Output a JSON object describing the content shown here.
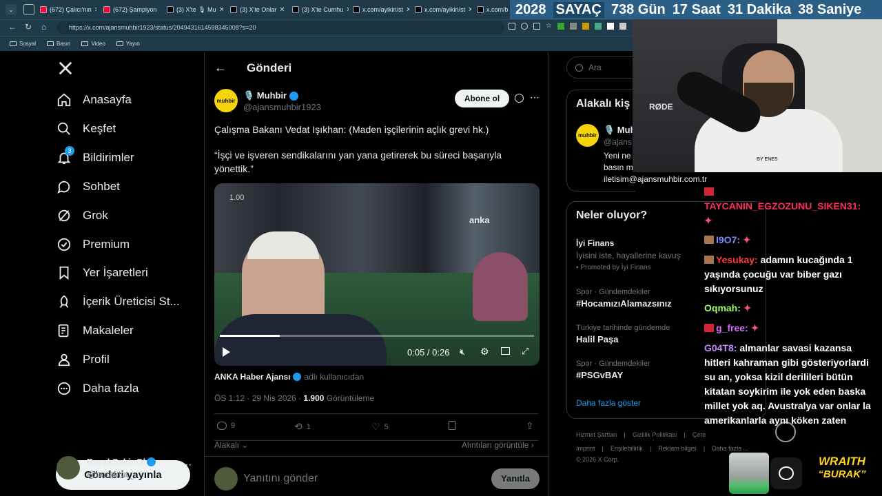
{
  "browser": {
    "tabs": [
      {
        "label": "(672) Çalıcı'nın",
        "color": "#ff0033"
      },
      {
        "label": "(672) Şampiyon",
        "color": "#ff0033"
      },
      {
        "label": "(3) X'te 🎙 Mu",
        "color": "#000000"
      },
      {
        "label": "(3) X'te Onlar",
        "color": "#000000"
      },
      {
        "label": "(3) X'te Cumhu",
        "color": "#000000"
      },
      {
        "label": "x.com/ayikiri/st",
        "color": "#000000"
      },
      {
        "label": "x.com/ayikiri/st",
        "color": "#000000"
      },
      {
        "label": "x.com/b",
        "color": "#000000"
      }
    ],
    "url": "https://x.com/ajansmuhbir1923/status/2049431614598345008?s=20",
    "bookmarks": [
      "Sosyal",
      "Basın",
      "Video",
      "Yayın"
    ]
  },
  "counter": {
    "year": "2028",
    "label": "SAYAÇ",
    "days": "738 Gün",
    "hours": "17 Saat",
    "minutes": "31 Dakika",
    "seconds": "38 Saniye"
  },
  "nav": {
    "items": [
      {
        "label": "Anasayfa",
        "icon": "home-icon"
      },
      {
        "label": "Keşfet",
        "icon": "search-icon"
      },
      {
        "label": "Bildirimler",
        "icon": "bell-icon",
        "badge": "3"
      },
      {
        "label": "Sohbet",
        "icon": "chat-icon"
      },
      {
        "label": "Grok",
        "icon": "grok-icon"
      },
      {
        "label": "Premium",
        "icon": "premium-icon"
      },
      {
        "label": "Yer İşaretleri",
        "icon": "bookmark-icon"
      },
      {
        "label": "İçerik Üreticisi St...",
        "icon": "rocket-icon"
      },
      {
        "label": "Makaleler",
        "icon": "article-icon"
      },
      {
        "label": "Profil",
        "icon": "profile-icon"
      },
      {
        "label": "Daha fazla",
        "icon": "more-circle-icon"
      }
    ],
    "post_button": "Gönderi yayınla",
    "account": {
      "name": "BurakSakinOl",
      "handle": "@buraktut_"
    }
  },
  "post": {
    "header_title": "Gönderi",
    "author_name": "🎙️ Muhbir",
    "author_handle": "@ajansmuhbir1923",
    "avatar_text": "muhbir",
    "subscribe_label": "Abone ol",
    "text_line1": "Çalışma Bakanı Vedat Işıkhan: (Maden işçilerinin açlık grevi hk.)",
    "text_line2": "“İşçi ve işveren sendikalarını yan yana getirerek bu süreci başarıyla yönettik.”",
    "video": {
      "watermark": "anka",
      "speed_overlay": "1.00",
      "time": "0:05 / 0:26",
      "progress": 0.19
    },
    "attribution_name": "ANKA Haber Ajansı",
    "attribution_suffix": "adlı kullanıcıdan",
    "meta_time": "ÖS 1:12 · 29 Nis 2026 · ",
    "meta_views": "1.900",
    "meta_views_label": " Görüntüleme",
    "replies": "9",
    "reposts": "1",
    "likes": "5",
    "relevant": "Alakalı",
    "quotes_link": "Alıntıları görüntüle",
    "reply_placeholder": "Yanıtını gönder",
    "reply_button": "Yanıtla"
  },
  "right": {
    "search_placeholder": "Ara",
    "related_title": "Alakalı kiş",
    "related_name": "🎙️ Muh",
    "related_handle": "@ajans",
    "related_bio1": "Yeni ne",
    "related_bio2": "basın m",
    "related_bio3": "iletisim@ajansmuhbir.com.tr",
    "trends_title": "Neler oluyor?",
    "promo_title": "İyi Finans",
    "promo_desc": "İyisini iste, hayallerine kavuş",
    "promo_tag": "Promoted by İyi Finans",
    "trends": [
      {
        "cat": "Spor · Gündemdekiler",
        "title": "#HocamızıAlamazsınız"
      },
      {
        "cat": "Türkiye tarihinde gündemde",
        "title": "Halil Paşa"
      },
      {
        "cat": "Spor · Gündemdekiler",
        "title": "#PSGvBAY"
      }
    ],
    "show_more": "Daha fazla göster",
    "footer_row1": [
      "Hizmet Şartları",
      "Gizlilik Politikası",
      "Çere"
    ],
    "footer_row2": [
      "Imprint",
      "Erişilebilirlik",
      "Reklam bilgisi",
      "Daha fazla ..."
    ],
    "copyright": "© 2026 X Corp."
  },
  "stream": {
    "mic_brand": "RØDE",
    "shirt_text": "BY ENES",
    "chat": [
      {
        "user": "TAYCANIN_EGZOZUNU_SIKEN31:",
        "user_color": "#ff2e5a",
        "msg": ""
      },
      {
        "user": "I9O7:",
        "user_color": "#7b8cff",
        "msg": ""
      },
      {
        "user": "Yesukay:",
        "user_color": "#ff3b3b",
        "msg": "adamın kucağında 1 yaşında çocuğu var biber gazı sıkıyorsunuz"
      },
      {
        "user": "Oqmah:",
        "user_color": "#9bff6a",
        "msg": ""
      },
      {
        "user": "g_free:",
        "user_color": "#d96bff",
        "msg": ""
      },
      {
        "user": "G04T8:",
        "user_color": "#c48bff",
        "msg": "almanlar savasi kazansa hitleri kahraman gibi gösteriyorlardi su an, yoksa kizil derilileri bütün kitatan soykirim ile yok eden baska millet yok aq. Avustralya var onlar la amerikanlarla aynı köken zaten"
      }
    ],
    "logo_line1": "WRAITH",
    "logo_line2": "“BURAK”"
  }
}
